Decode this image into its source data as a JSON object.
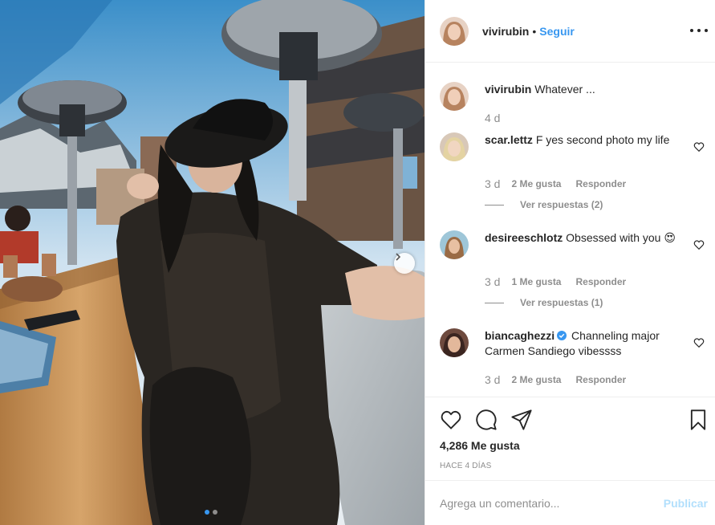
{
  "post": {
    "author": "vivirubin",
    "separator": "•",
    "follow_label": "Seguir",
    "more_icon": "more-options-icon",
    "photo": {
      "slide_count": 2,
      "active_slide": 1,
      "next_icon": "chevron-right-icon"
    },
    "caption": {
      "username": "vivirubin",
      "text": "Whatever ...",
      "time": "4 d"
    },
    "comments": [
      {
        "username": "scar.lettz",
        "text": "F yes second photo my life",
        "time": "3 d",
        "likes": "2 Me gusta",
        "reply_label": "Responder",
        "view_replies": "Ver respuestas (2)"
      },
      {
        "username": "desireeschlotz",
        "text": "Obsessed with you 😍",
        "time": "3 d",
        "likes": "1 Me gusta",
        "reply_label": "Responder",
        "view_replies": "Ver respuestas (1)"
      },
      {
        "username": "biancaghezzi",
        "verified": true,
        "text": "Channeling major Carmen Sandiego vibessss",
        "time": "3 d",
        "likes": "2 Me gusta",
        "reply_label": "Responder"
      }
    ],
    "likes_count": "4,286 Me gusta",
    "posted_ago": "HACE 4 DÍAS",
    "comment_placeholder": "Agrega un comentario...",
    "publish_label": "Publicar",
    "colors": {
      "link": "#3897f0",
      "muted": "#8e8e8e",
      "publish_disabled": "#b2dffc",
      "text": "#262626"
    }
  }
}
